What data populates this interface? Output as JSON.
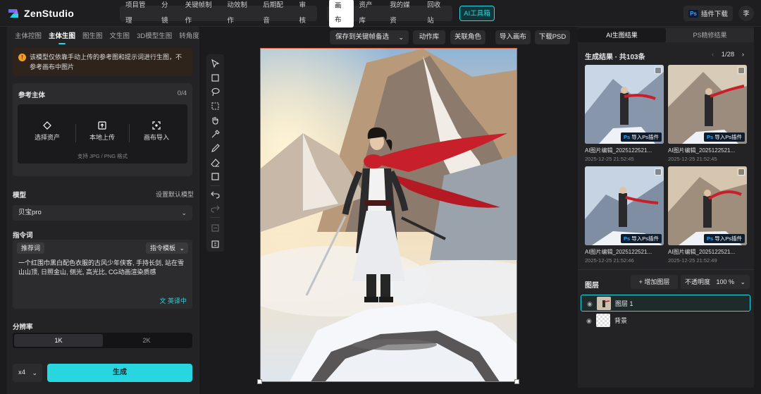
{
  "app": {
    "name": "ZenStudio"
  },
  "topnav": {
    "group1": [
      "项目管理",
      "分镜",
      "关键帧制作",
      "动效制作",
      "后期配音",
      "审核"
    ],
    "group2_active": "画布",
    "group2": [
      "资产库",
      "我的媒资",
      "回收站"
    ],
    "ai_tools": "AI工具箱",
    "ps_download": "插件下载",
    "ps_badge": "Ps",
    "user_initial": "李"
  },
  "left": {
    "tabs": [
      "主体控图",
      "主体生图",
      "图生图",
      "文生图",
      "3D模型生图",
      "转角度"
    ],
    "active_tab": "主体生图",
    "notice": "该模型仅依靠手动上传的参考图和提示词进行生图，不参考画布中图片",
    "reference": {
      "title": "参考主体",
      "count": "0/4",
      "options": [
        "选择资产",
        "本地上传",
        "画布导入"
      ],
      "hint": "支持 JPG / PNG 格式"
    },
    "model": {
      "label": "模型",
      "link": "设置默认模型",
      "value": "贝宝pro"
    },
    "prompt": {
      "label": "指令词",
      "recommend": "推荐词",
      "template": "指令模板",
      "text": "一个红围巾黑白配色衣服的古风少年侠客, 手持长剑, 站在雪山山顶, 日照金山, 侧光, 高光比, CG动画渲染质感",
      "translate": "英译中"
    },
    "resolution": {
      "label": "分辨率",
      "options": [
        "1K",
        "2K"
      ],
      "selected": "1K"
    },
    "quantity": "x4",
    "generate": "生成"
  },
  "canvas_toolbar": {
    "save_keyframe": "保存到关键帧备选",
    "action_lib": "动作库",
    "link_role": "关联角色",
    "import_canvas": "导入画布",
    "download_psd": "下载PSD"
  },
  "tools": [
    "select-tool-icon",
    "crop-tool-icon",
    "lasso-tool-icon",
    "marquee-tool-icon",
    "hand-tool-icon",
    "eyedropper-tool-icon",
    "brush-tool-icon",
    "eraser-tool-icon",
    "rectangle-tool-icon",
    "undo-icon",
    "redo-icon",
    "layers-icon",
    "export-icon"
  ],
  "right": {
    "tabs": [
      "AI生图结果",
      "PS精修结果"
    ],
    "active_tab": "AI生图结果",
    "results_title": "生成结果 · 共103条",
    "pager": "1/28",
    "results": [
      {
        "name": "AI图片编辑_2025122521...",
        "date": "2025-12-25 21:52:45",
        "tag": "导入Ps插件"
      },
      {
        "name": "AI图片编辑_2025122521...",
        "date": "2025-12-25 21:52:45",
        "tag": "导入Ps插件"
      },
      {
        "name": "AI图片编辑_2025122521...",
        "date": "2025-12-25 21:52:46",
        "tag": "导入Ps插件"
      },
      {
        "name": "AI图片编辑_2025122521...",
        "date": "2025-12-25 21:52:49",
        "tag": "导入Ps插件"
      }
    ],
    "layers": {
      "title": "图层",
      "add": "增加图层",
      "opacity_label": "不透明度",
      "opacity_value": "100 %",
      "items": [
        {
          "name": "图层 1",
          "selected": true
        },
        {
          "name": "背景",
          "selected": false
        }
      ]
    }
  },
  "colors": {
    "accent": "#28d6e0",
    "bg": "#1b1b1d",
    "panel": "#232325",
    "warning": "#f0a028"
  }
}
